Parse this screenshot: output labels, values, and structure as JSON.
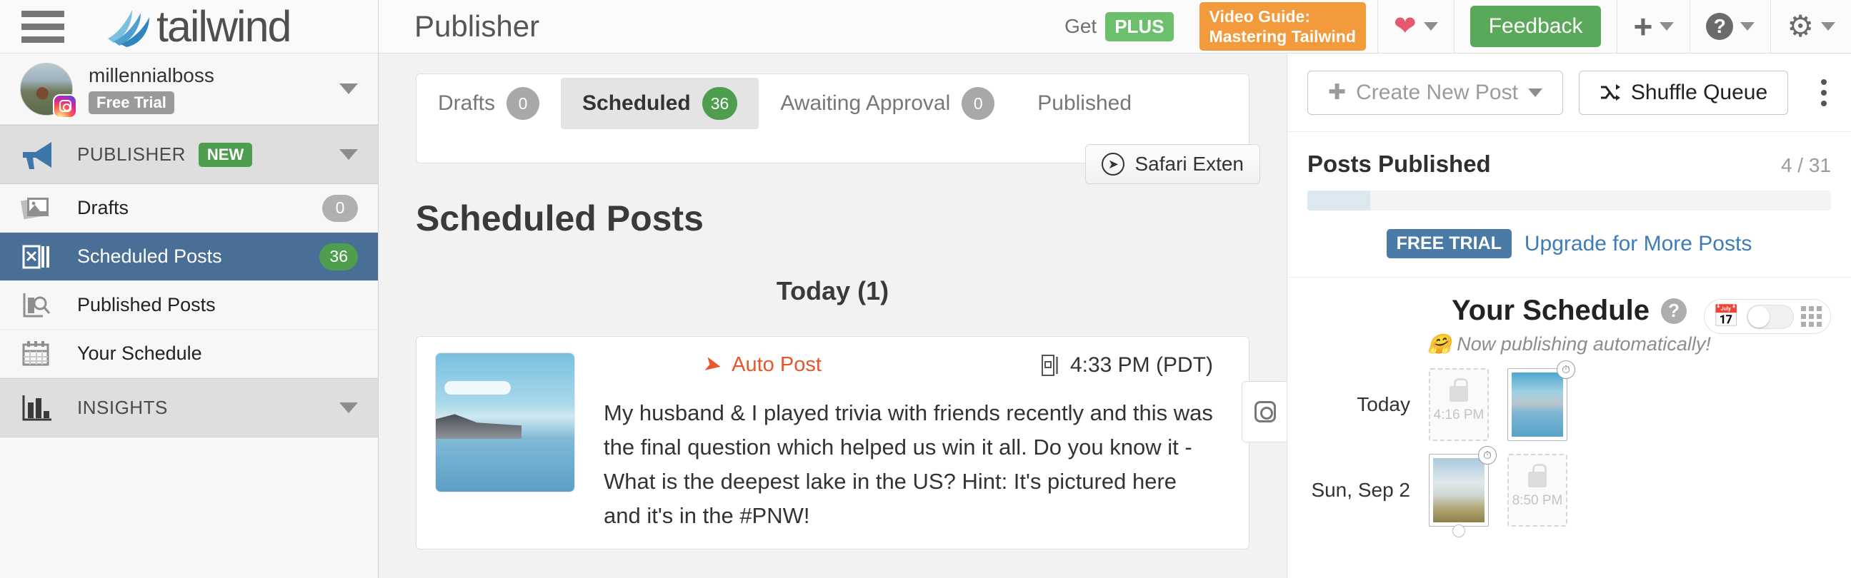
{
  "sidebar": {
    "hamburger_icon": "hamburger-menu-icon",
    "brand": "tailwind",
    "account": {
      "name": "millennialboss",
      "plan_badge": "Free Trial"
    },
    "section": {
      "label": "PUBLISHER",
      "badge": "NEW"
    },
    "items": [
      {
        "label": "Drafts",
        "count": "0",
        "icon": "photos-icon",
        "active": false,
        "green": false
      },
      {
        "label": "Scheduled Posts",
        "count": "36",
        "icon": "scheduled-icon",
        "active": true,
        "green": true
      },
      {
        "label": "Published Posts",
        "count": "",
        "icon": "published-icon",
        "active": false,
        "green": false
      },
      {
        "label": "Your Schedule",
        "count": "",
        "icon": "calendar-icon",
        "active": false,
        "green": false
      }
    ],
    "insights": {
      "label": "INSIGHTS",
      "icon": "bar-chart-icon"
    }
  },
  "topbar": {
    "title": "Publisher",
    "get_label": "Get",
    "plus_chip": "PLUS",
    "video_guide_line1": "Video Guide:",
    "video_guide_line2": "Mastering Tailwind",
    "heart_icon": "heart-icon",
    "feedback_label": "Feedback",
    "plus_icon": "plus-icon",
    "help_icon": "question-mark-icon",
    "gear_icon": "gear-icon"
  },
  "tabs": [
    {
      "label": "Drafts",
      "count": "0",
      "active": false,
      "green": false
    },
    {
      "label": "Scheduled",
      "count": "36",
      "active": true,
      "green": true
    },
    {
      "label": "Awaiting Approval",
      "count": "0",
      "active": false,
      "green": false
    },
    {
      "label": "Published",
      "count": "",
      "active": false,
      "green": false
    }
  ],
  "safari_button": {
    "label": "Safari Exten",
    "icon": "safari-compass-icon"
  },
  "content": {
    "section_title": "Scheduled Posts",
    "today_heading": "Today (1)",
    "post": {
      "auto_post_label": "Auto Post",
      "auto_post_icon": "send-icon",
      "time": "4:33 PM (PDT)",
      "time_icon": "instagram-story-icon",
      "text": "My husband & I played trivia with friends recently and this was the final question which helped us win it all.  Do you know it - What is the deepest lake in the US?  Hint: It's pictured here and it's in the #PNW!",
      "thumb_alt": "crater-lake-photo",
      "channel_icon": "instagram-icon"
    }
  },
  "right_panel": {
    "create_post_label": "Create New Post",
    "create_post_icon": "plus-icon",
    "shuffle_label": "Shuffle Queue",
    "shuffle_icon": "shuffle-icon",
    "kebab_icon": "more-options-icon",
    "posts_published": {
      "title": "Posts Published",
      "count": "4 / 31",
      "progress_percent": 12
    },
    "free_trial_chip": "FREE TRIAL",
    "upgrade_link": "Upgrade for More Posts",
    "schedule": {
      "title": "Your Schedule",
      "help_icon": "question-mark-icon",
      "subtitle": "Now publishing automatically!",
      "subtitle_emoji": "🤗",
      "calendar_icon": "calendar-icon",
      "grid_icon": "grid-view-icon",
      "rows": [
        {
          "day": "Today",
          "slots": [
            {
              "type": "empty",
              "time": "4:16 PM",
              "icon": "lock-icon"
            },
            {
              "type": "filled",
              "image": "crater-lake-thumb",
              "badge_icon": "clock-icon"
            }
          ]
        },
        {
          "day": "Sun, Sep 2",
          "slots": [
            {
              "type": "filled",
              "image": "mountain-lake-thumb",
              "badge_icon": "clock-icon"
            },
            {
              "type": "empty",
              "time": "8:50 PM",
              "icon": "lock-icon"
            }
          ]
        }
      ]
    }
  },
  "colors": {
    "accent_blue": "#4a6f96",
    "green": "#4f9d4f",
    "orange": "#f29a3c",
    "link_blue": "#3c7cb8",
    "auto_post_orange": "#e8562a"
  }
}
